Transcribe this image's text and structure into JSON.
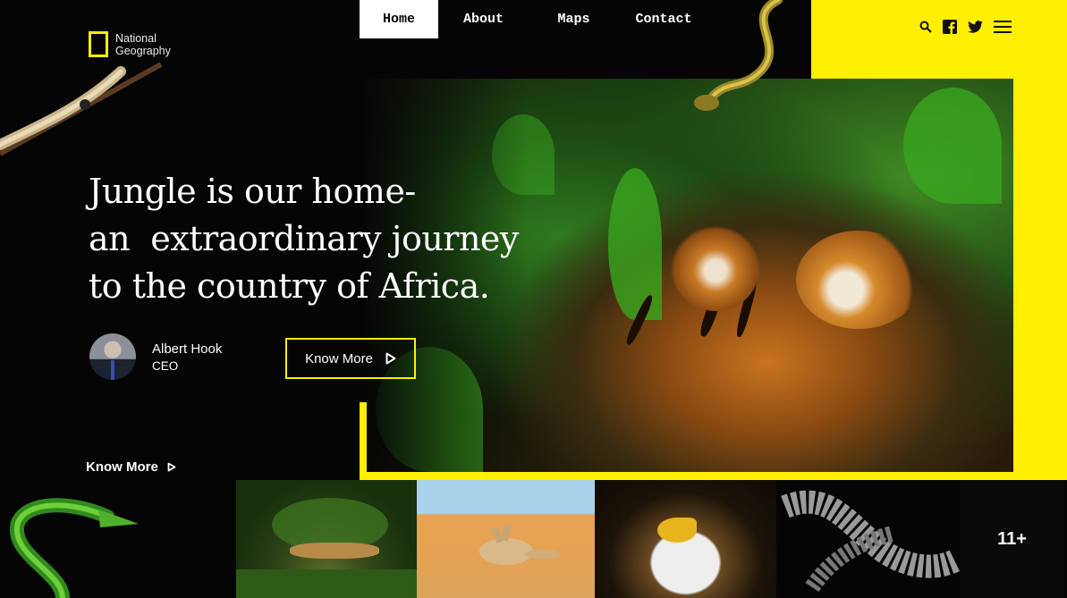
{
  "brand": {
    "line1": "National",
    "line2": "Geography",
    "accent": "#ffef00"
  },
  "nav": {
    "items": [
      {
        "label": "Home",
        "active": true
      },
      {
        "label": "About"
      },
      {
        "label": "Maps"
      },
      {
        "label": "Contact"
      }
    ]
  },
  "header_icons": [
    "search-icon",
    "facebook-icon",
    "twitter-icon",
    "menu-icon"
  ],
  "hero": {
    "headline": {
      "line1": "Jungle is our home-",
      "line2": "an  extraordinary journey",
      "line3": "to the country of Africa."
    },
    "author": {
      "name": "Albert Hook",
      "role": "CEO"
    },
    "cta_label": "Know More",
    "secondary_cta_label": "Know More"
  },
  "gallery": {
    "more_count": "11+"
  }
}
